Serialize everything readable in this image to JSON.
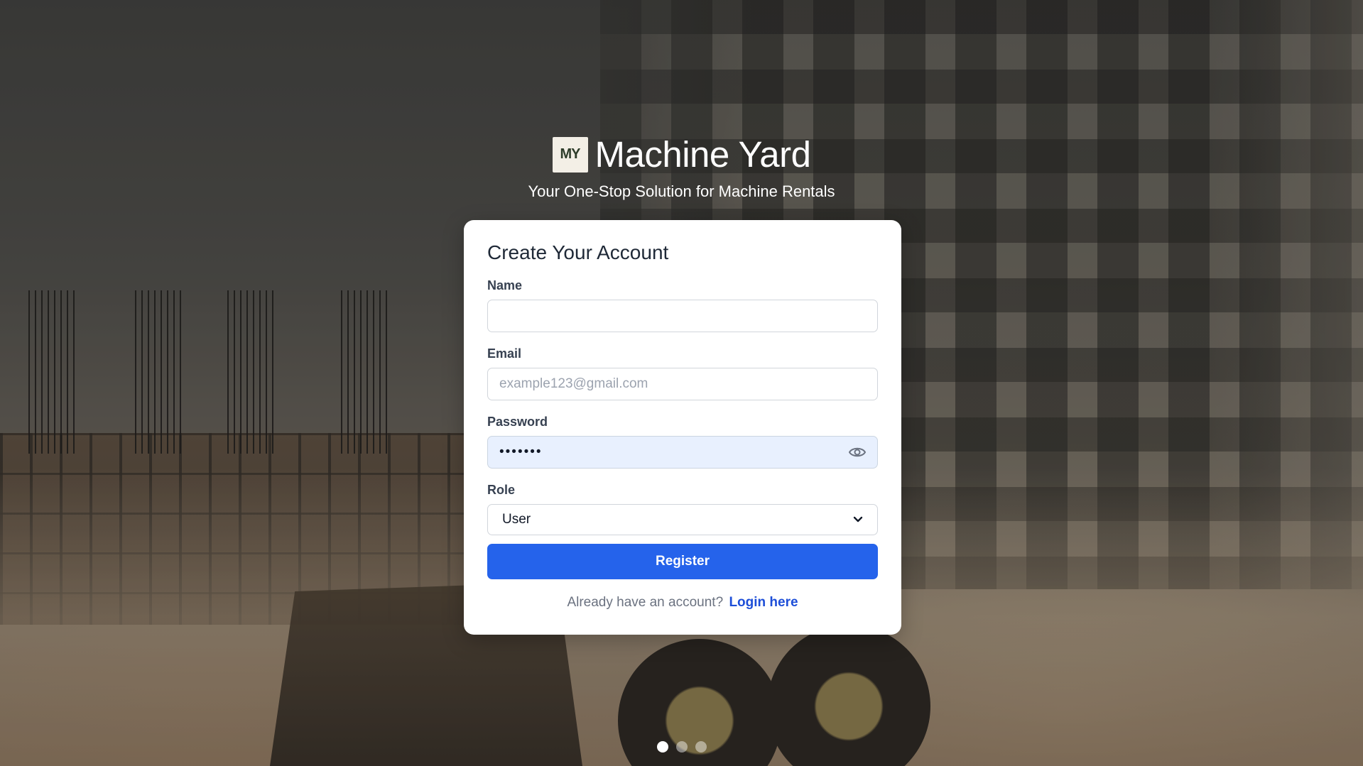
{
  "brand": {
    "logo_text": "MY",
    "title": "Machine Yard",
    "tagline": "Your One-Stop Solution for Machine Rentals"
  },
  "form": {
    "title": "Create Your Account",
    "name": {
      "label": "Name",
      "value": "",
      "placeholder": ""
    },
    "email": {
      "label": "Email",
      "value": "",
      "placeholder": "example123@gmail.com"
    },
    "password": {
      "label": "Password",
      "value": "•••••••",
      "toggle_icon": "eye-icon"
    },
    "role": {
      "label": "Role",
      "selected": "User",
      "icon": "chevron-down-icon"
    },
    "register_label": "Register",
    "footer_text": "Already have an account?",
    "login_link": "Login here"
  },
  "carousel": {
    "count": 3,
    "active_index": 0
  },
  "colors": {
    "primary": "#2563eb",
    "link": "#1d4ed8",
    "card_bg": "#ffffff",
    "password_bg": "#e8f0fe"
  }
}
